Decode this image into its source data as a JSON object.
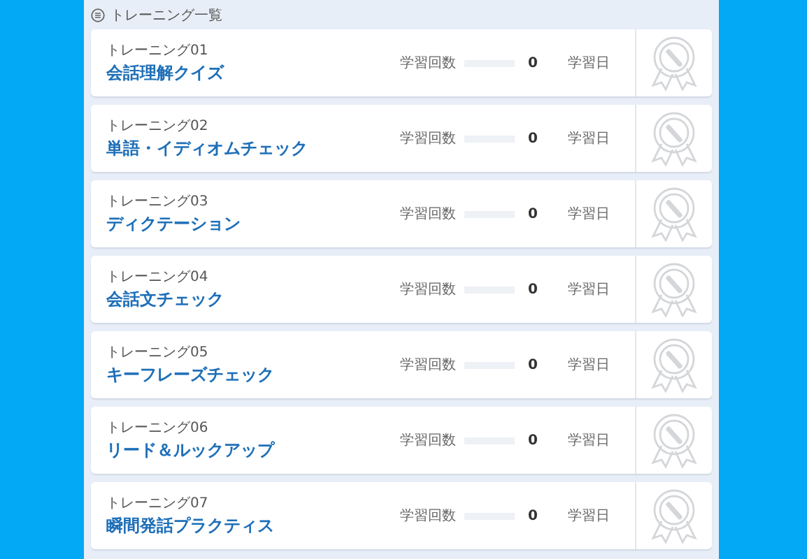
{
  "header": {
    "title": "トレーニング一覧"
  },
  "trainings": [
    {
      "number": "トレーニング01",
      "title": "会話理解クイズ",
      "count_label": "学習回数",
      "level": 0,
      "count": "0",
      "date_label": "学習日"
    },
    {
      "number": "トレーニング02",
      "title": "単語・イディオムチェック",
      "count_label": "学習回数",
      "level": 0,
      "count": "0",
      "date_label": "学習日"
    },
    {
      "number": "トレーニング03",
      "title": "ディクテーション",
      "count_label": "学習回数",
      "level": 0,
      "count": "0",
      "date_label": "学習日"
    },
    {
      "number": "トレーニング04",
      "title": "会話文チェック",
      "count_label": "学習回数",
      "level": 0,
      "count": "0",
      "date_label": "学習日"
    },
    {
      "number": "トレーニング05",
      "title": "キーフレーズチェック",
      "count_label": "学習回数",
      "level": 0,
      "count": "0",
      "date_label": "学習日"
    },
    {
      "number": "トレーニング06",
      "title": "リード＆ルックアップ",
      "count_label": "学習回数",
      "level": 0,
      "count": "0",
      "date_label": "学習日"
    },
    {
      "number": "トレーニング07",
      "title": "瞬間発話プラクティス",
      "count_label": "学習回数",
      "level": 0,
      "count": "0",
      "date_label": "学習日"
    }
  ]
}
